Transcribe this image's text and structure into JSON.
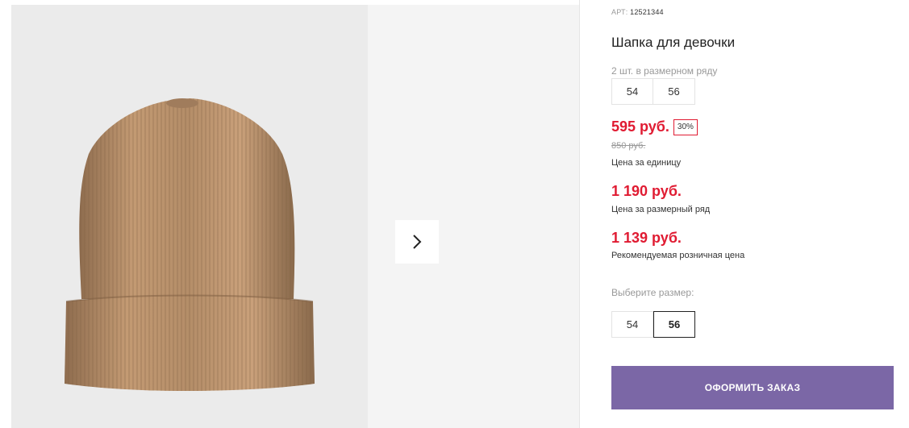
{
  "product": {
    "art_label": "АРТ:",
    "art_value": "12521344",
    "title": "Шапка для девочки"
  },
  "pack": {
    "note": "2 шт. в размерном ряду",
    "sizes": [
      "54",
      "56"
    ]
  },
  "price": {
    "current": "595 руб.",
    "discount": "30%",
    "old": "850 руб.",
    "unit_caption": "Цена за единицу",
    "row_price": "1 190 руб.",
    "row_caption": "Цена за размерный ряд",
    "rrp_price": "1 139 руб.",
    "rrp_caption": "Рекомендуемая розничная цена"
  },
  "size_select": {
    "label": "Выберите размер:",
    "options": [
      "54",
      "56"
    ],
    "selected": "56"
  },
  "order_button": "ОФОРМИТЬ ЗАКАЗ",
  "colors": {
    "price_red": "#e01b32",
    "button_purple": "#7b67a6",
    "hat_gold": "#b08a66"
  },
  "icons": {
    "next": "chevron-right-icon"
  }
}
